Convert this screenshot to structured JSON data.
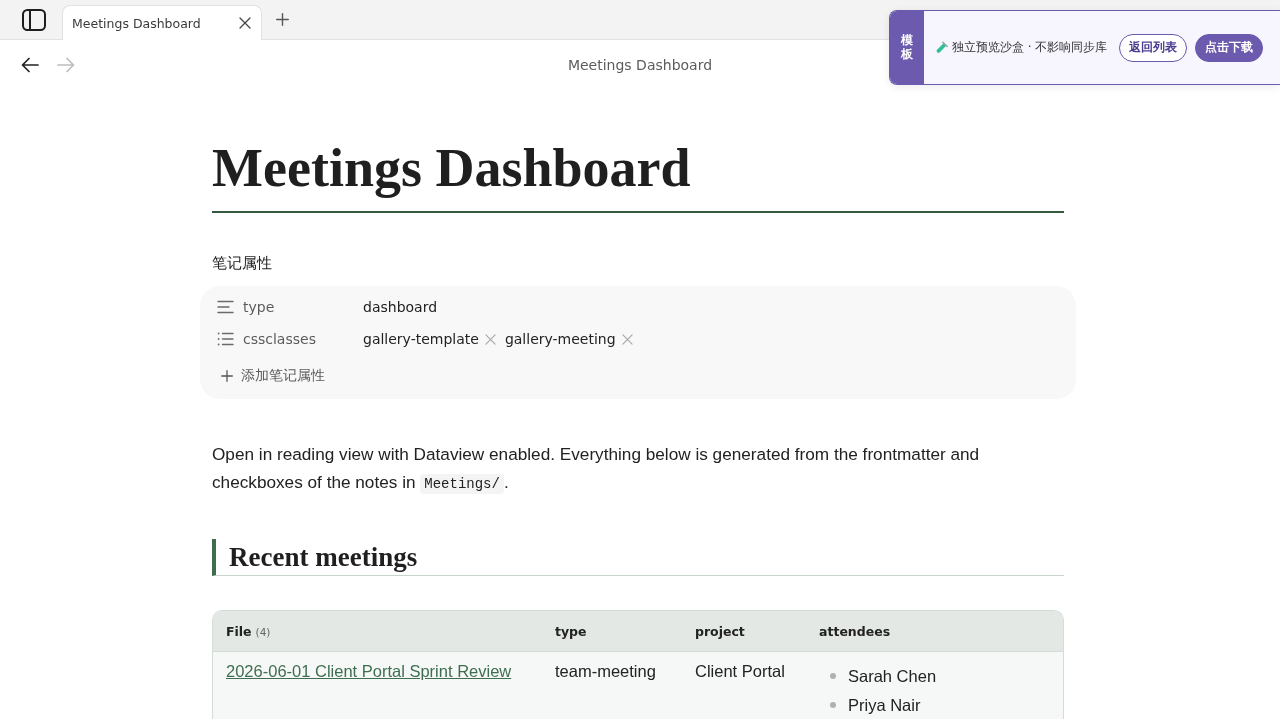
{
  "tabs": [
    {
      "title": "Meetings Dashboard",
      "selected": true
    }
  ],
  "navigation": [
    {
      "kind": "back",
      "disabled": false
    },
    {
      "kind": "forward",
      "disabled": true
    }
  ],
  "view_title": "Meetings Dashboard",
  "template_banner": {
    "badge": "模板",
    "message": "独立预览沙盒 · 不影响同步库",
    "buttons": [
      {
        "label": "返回列表",
        "kind": "outline"
      },
      {
        "label": "点击下载",
        "kind": "filled"
      }
    ]
  },
  "note": {
    "title": "Meetings Dashboard",
    "properties": {
      "heading": "笔记属性",
      "items": [
        {
          "kind": "text",
          "key": "type",
          "value": "dashboard"
        },
        {
          "kind": "list",
          "key": "cssclasses",
          "values": [
            "gallery-template",
            "gallery-meeting"
          ]
        }
      ],
      "add_label": "添加笔记属性"
    },
    "intro": {
      "text": "Open in reading view with Dataview enabled. Everything below is generated from the frontmatter and checkboxes of the notes in",
      "code": "Meetings/",
      "end": "."
    },
    "sections": [
      {
        "heading": "Recent meetings",
        "table": {
          "columns": [
            {
              "label": "File",
              "count": "(4)"
            },
            {
              "label": "type"
            },
            {
              "label": "project"
            },
            {
              "label": "attendees"
            }
          ],
          "rows": [
            {
              "file": "2026-06-01 Client Portal Sprint Review",
              "type": "team-meeting",
              "project": "Client Portal",
              "attendees": [
                "Sarah Chen",
                "Priya Nair"
              ]
            }
          ]
        }
      }
    ]
  }
}
